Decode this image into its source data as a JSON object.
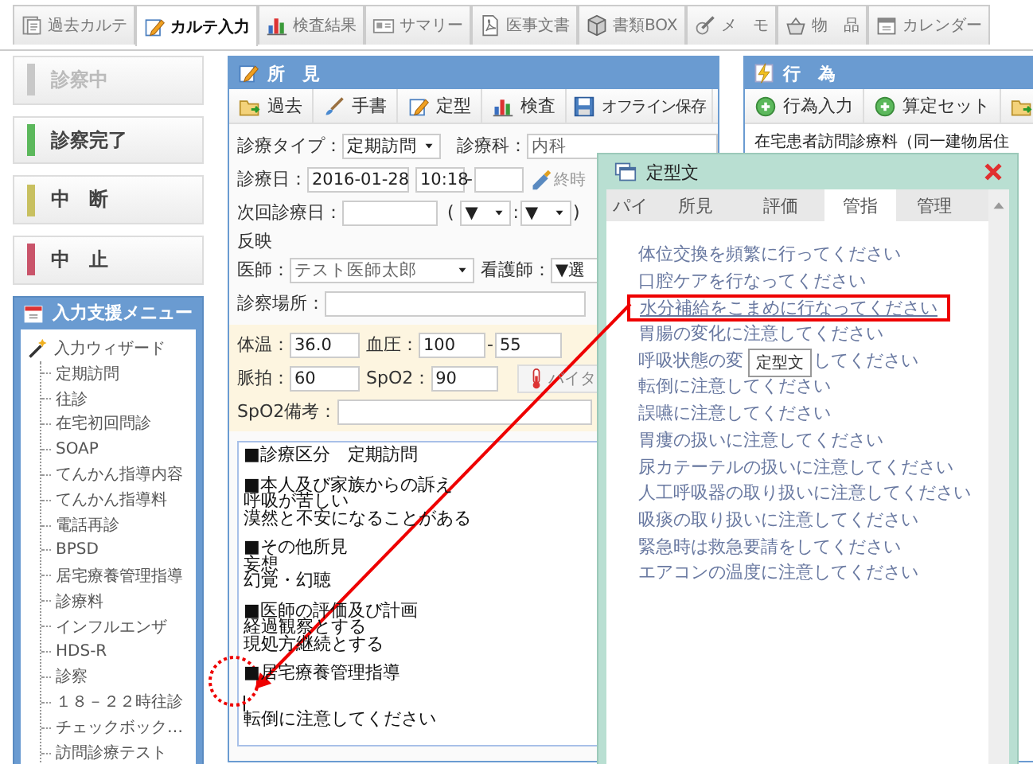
{
  "top_tabs": [
    {
      "label": "過去カルテ",
      "selected": false
    },
    {
      "label": "カルテ入力",
      "selected": true
    },
    {
      "label": "検査結果",
      "selected": false
    },
    {
      "label": "サマリー",
      "selected": false
    },
    {
      "label": "医事文書",
      "selected": false
    },
    {
      "label": "書類BOX",
      "selected": false
    },
    {
      "label": "メ　モ",
      "selected": false
    },
    {
      "label": "物　品",
      "selected": false
    },
    {
      "label": "カレンダー",
      "selected": false
    }
  ],
  "status_buttons": [
    {
      "label": "診察中",
      "color": "#c8c8c8",
      "disabled": true
    },
    {
      "label": "診察完了",
      "color": "#5cb85c",
      "disabled": false
    },
    {
      "label": "中　断",
      "color": "#c8c060",
      "disabled": false
    },
    {
      "label": "中　止",
      "color": "#c9546a",
      "disabled": false
    }
  ],
  "assist_menu": {
    "title": "入力支援メニュー",
    "root": {
      "label": "入力ウィザード",
      "children": [
        {
          "label": "定期訪問"
        },
        {
          "label": "往診"
        },
        {
          "label": "在宅初回問診"
        },
        {
          "label": "SOAP"
        },
        {
          "label": "てんかん指導内容"
        },
        {
          "label": "てんかん指導料"
        },
        {
          "label": "電話再診"
        },
        {
          "label": "BPSD"
        },
        {
          "label": "居宅療養管理指導"
        },
        {
          "label": "診療料"
        },
        {
          "label": "インフルエンザ"
        },
        {
          "label": "HDS-R"
        },
        {
          "label": "診察"
        },
        {
          "label": "１８－２２時往診"
        },
        {
          "label": "チェックボック…"
        },
        {
          "label": "訪問診療テスト"
        }
      ]
    }
  },
  "findings_panel": {
    "title": "所　見",
    "toolbar": [
      "過去",
      "手書",
      "定型",
      "検査",
      "オフライン保存"
    ],
    "visit_type": {
      "label": "診療タイプ：",
      "value": "定期訪問"
    },
    "department": {
      "label": "診療科：",
      "value": "内科"
    },
    "visit_date": {
      "label": "診療日：",
      "date": "2016-01-28",
      "start": "10:18",
      "separator": "-",
      "end_button": "終時"
    },
    "next_date": {
      "label": "次回診療日：",
      "open": "(",
      "hour": "▼",
      "colon": ":",
      "minute": "▼",
      "close": ")"
    },
    "reflect": "反映",
    "doctor": {
      "label": "医師：",
      "value": "テスト医師太郎"
    },
    "nurse": {
      "label": "看護師：",
      "value": "▼選"
    },
    "place": {
      "label": "診察場所："
    },
    "vitals": {
      "temp": {
        "label": "体温：",
        "value": "36.0"
      },
      "bp": {
        "label": "血圧：",
        "high": "100",
        "separator": "-",
        "low": "55"
      },
      "pulse": {
        "label": "脈拍：",
        "value": "60"
      },
      "spo2": {
        "label": "SpO2：",
        "value": "90"
      },
      "vital_button": "バイタ",
      "spo2_note": {
        "label": "SpO2備考："
      }
    },
    "note": {
      "blocks": [
        [
          "■診療区分　定期訪問"
        ],
        [
          "■本人及び家族からの訴え",
          "呼吸が苦しい",
          "漠然と不安になることがある"
        ],
        [
          "■その他所見",
          "妄想",
          "幻覚・幻聴"
        ],
        [
          "■医師の評価及び計画",
          "経過観察とする",
          "現処方継続とする"
        ],
        [
          "■居宅療養管理指導"
        ]
      ],
      "cursor": true,
      "inserted": "転倒に注意してください"
    }
  },
  "actions_panel": {
    "title": "行　為",
    "toolbar": [
      "行為入力",
      "算定セット"
    ],
    "rows": [
      "在宅患者訪問診療料（同一建物居住"
    ]
  },
  "template_dialog": {
    "title": "定型文",
    "tabs": [
      {
        "label": "パイ",
        "selected": false
      },
      {
        "label": "所見",
        "selected": false
      },
      {
        "label": "評価",
        "selected": false
      },
      {
        "label": "管指",
        "selected": true
      },
      {
        "label": "管理",
        "selected": false
      }
    ],
    "items": [
      {
        "label": "体位交換を頻繁に行ってください",
        "highlighted": false
      },
      {
        "label": "口腔ケアを行なってください",
        "highlighted": false
      },
      {
        "label": "水分補給をこまめに行なってください",
        "highlighted": true
      },
      {
        "label": "胃腸の変化に注意してください",
        "highlighted": false
      },
      {
        "segments": [
          "呼吸状態の変",
          "してください"
        ],
        "highlighted": false
      },
      {
        "label": "転倒に注意してください",
        "highlighted": false
      },
      {
        "label": "誤嚥に注意してください",
        "highlighted": false
      },
      {
        "label": "胃瘻の扱いに注意してください",
        "highlighted": false
      },
      {
        "label": "尿カテーテルの扱いに注意してください",
        "highlighted": false
      },
      {
        "label": "人工呼吸器の取り扱いに注意してください",
        "highlighted": false
      },
      {
        "label": "吸痰の取り扱いに注意してください",
        "highlighted": false
      },
      {
        "label": "緊急時は救急要請をしてください",
        "highlighted": false
      },
      {
        "label": "エアコンの温度に注意してください",
        "highlighted": false
      }
    ],
    "tooltip": "定型文"
  }
}
